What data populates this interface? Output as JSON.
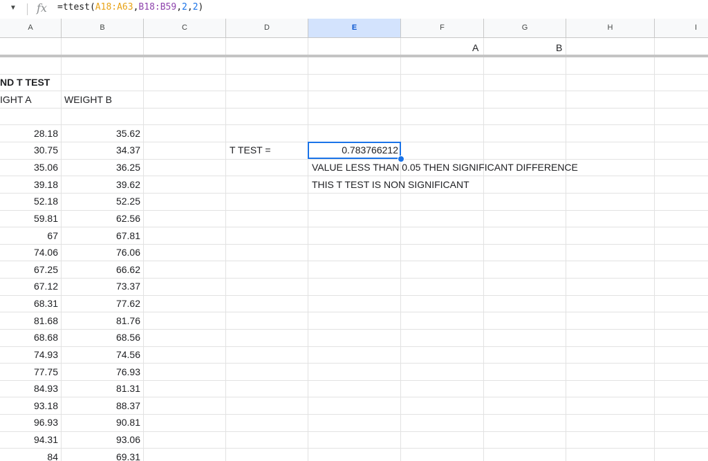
{
  "formula_bar": {
    "caret_icon": "dropdown-caret-icon",
    "fx_label": "fx",
    "formula_prefix": "=ttest(",
    "formula_ref1": "A18:A63",
    "formula_comma1": ",",
    "formula_ref2": "B18:B59",
    "formula_rest_a": ",",
    "formula_num1": "2",
    "formula_rest_b": ",",
    "formula_num2": "2",
    "formula_close": ")"
  },
  "columns": [
    "A",
    "B",
    "C",
    "D",
    "E",
    "F",
    "G",
    "H",
    "I"
  ],
  "selected_column": "E",
  "frozen": {
    "f_label": "A",
    "g_label": "B"
  },
  "sheet": {
    "title": "ND T TEST",
    "header_a": "IGHT A",
    "header_b": "WEIGHT B",
    "rows": [
      [
        "28.18",
        "35.62"
      ],
      [
        "30.75",
        "34.37"
      ],
      [
        "35.06",
        "36.25"
      ],
      [
        "39.18",
        "39.62"
      ],
      [
        "52.18",
        "52.25"
      ],
      [
        "59.81",
        "62.56"
      ],
      [
        "67",
        "67.81"
      ],
      [
        "74.06",
        "76.06"
      ],
      [
        "67.25",
        "66.62"
      ],
      [
        "67.12",
        "73.37"
      ],
      [
        "68.31",
        "77.62"
      ],
      [
        "81.68",
        "81.76"
      ],
      [
        "68.68",
        "68.56"
      ],
      [
        "74.93",
        "74.56"
      ],
      [
        "77.75",
        "76.93"
      ],
      [
        "84.93",
        "81.31"
      ],
      [
        "93.18",
        "88.37"
      ],
      [
        "96.93",
        "90.81"
      ],
      [
        "94.31",
        "93.06"
      ],
      [
        "84",
        "69.31"
      ]
    ],
    "ttest_label": "T TEST =",
    "ttest_value": "0.783766212",
    "note1": "VALUE LESS THAN 0.05 THEN SIGNIFICANT DIFFERENCE",
    "note2": "THIS T TEST IS NON SIGNIFICANT"
  },
  "colors": {
    "accent": "#1a73e8",
    "header_bg": "#f8f9fa",
    "selected_header_bg": "#d3e3fd"
  }
}
